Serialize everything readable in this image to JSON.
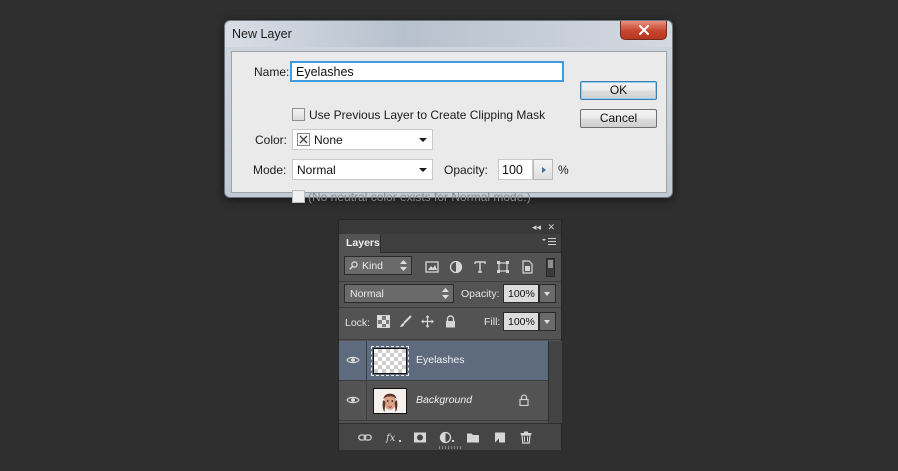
{
  "dialog": {
    "title": "New Layer",
    "name_label": "Name:",
    "name_value": "Eyelashes",
    "clipping_label": "Use Previous Layer to Create Clipping Mask",
    "color_label": "Color:",
    "color_value": "None",
    "mode_label": "Mode:",
    "mode_value": "Normal",
    "opacity_label": "Opacity:",
    "opacity_value": "100",
    "percent": "%",
    "neutral_label": "(No neutral color exists for Normal mode.)",
    "ok_label": "OK",
    "cancel_label": "Cancel",
    "close_color": "#c6452d",
    "focus_color": "#3e9bdd"
  },
  "panel": {
    "tab": "Layers",
    "filter_kind": "Kind",
    "blend_mode": "Normal",
    "opacity_label": "Opacity:",
    "opacity_value": "100%",
    "lock_label": "Lock:",
    "fill_label": "Fill:",
    "fill_value": "100%",
    "layers": [
      {
        "name": "Eyelashes",
        "selected": true,
        "visible": true,
        "locked": false
      },
      {
        "name": "Background",
        "selected": false,
        "visible": true,
        "locked": true
      }
    ],
    "selected_color": "#5e6b7e"
  }
}
